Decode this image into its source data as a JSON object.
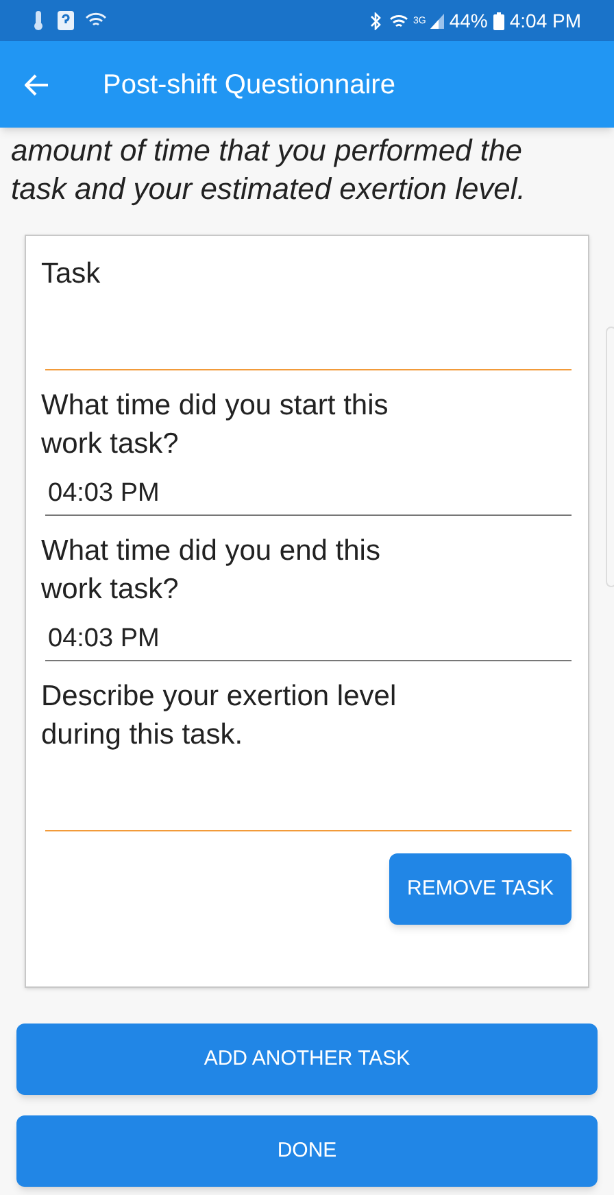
{
  "status_bar": {
    "network": "3G",
    "battery": "44%",
    "time": "4:04 PM"
  },
  "app_bar": {
    "title": "Post-shift Questionnaire"
  },
  "intro_lines": [
    "amount of time that you performed the",
    "task and your estimated exertion level."
  ],
  "task_card": {
    "fields": [
      {
        "label": "Task",
        "invalid": true
      },
      {
        "label": "What time did you start this work task?",
        "value": "04:03 PM",
        "invalid": false
      },
      {
        "label": "What time did you end this work task?",
        "value": "04:03 PM",
        "invalid": false
      },
      {
        "label": "Describe your exertion level during this task.",
        "invalid": true
      }
    ],
    "remove_button": "REMOVE TASK"
  },
  "buttons": [
    "ADD ANOTHER TASK",
    "DONE"
  ]
}
